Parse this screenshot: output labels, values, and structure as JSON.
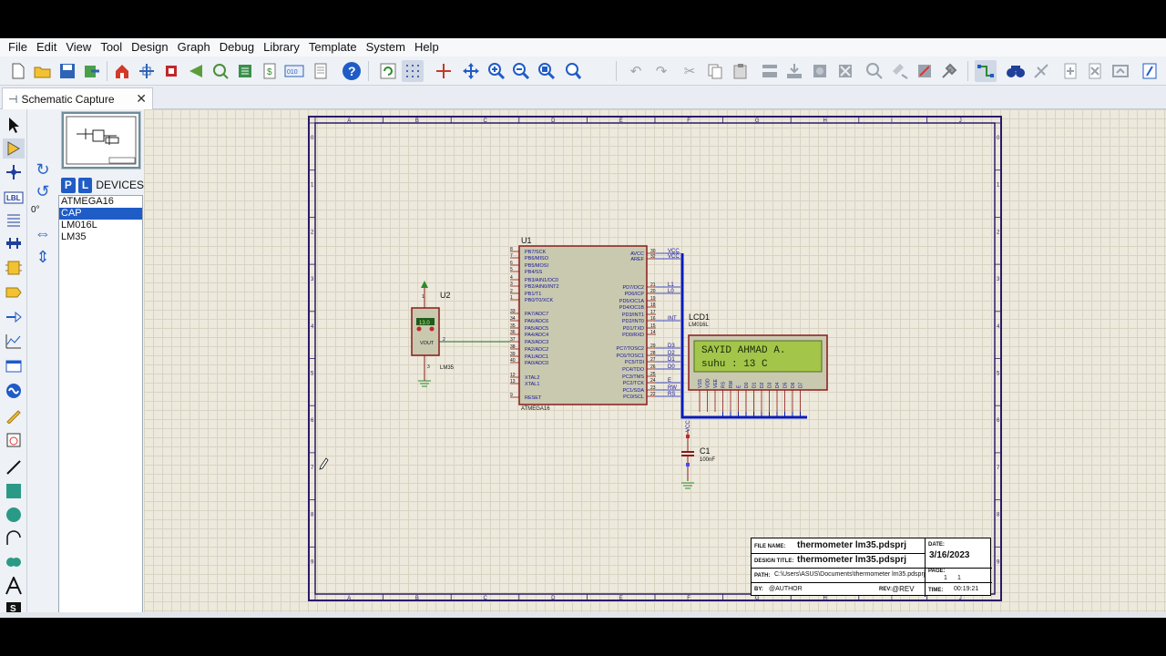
{
  "menu": [
    "File",
    "Edit",
    "View",
    "Tool",
    "Design",
    "Graph",
    "Debug",
    "Library",
    "Template",
    "System",
    "Help"
  ],
  "tab": {
    "label": "Schematic Capture"
  },
  "rotation": {
    "angle": "0°"
  },
  "devices": {
    "pick_button": "P",
    "library_button": "L",
    "title": "DEVICES",
    "items": [
      "ATMEGA16",
      "CAP",
      "LM016L",
      "LM35"
    ],
    "selected": "CAP"
  },
  "schematic": {
    "u1": {
      "ref": "U1",
      "part": "ATMEGA16",
      "left_pins": [
        "PB7/SCK",
        "PB6/MISO",
        "PB5/MOSI",
        "PB4/SS",
        "PB3/AIN1/OC0",
        "PB2/AIN0/INT2",
        "PB1/T1",
        "PB0/T0/XCK",
        "PA7/ADC7",
        "PA6/ADC6",
        "PA5/ADC5",
        "PA4/ADC4",
        "PA3/ADC3",
        "PA2/ADC2",
        "PA1/ADC1",
        "PA0/ADC0",
        "XTAL2",
        "XTAL1",
        "RESET"
      ],
      "left_nums": [
        "8",
        "7",
        "6",
        "5",
        "4",
        "3",
        "2",
        "1",
        "33",
        "34",
        "35",
        "36",
        "37",
        "38",
        "39",
        "40",
        "12",
        "13",
        "9"
      ],
      "right_pins": [
        "AVCC",
        "AREF",
        "PD7/OC2",
        "PD6/ICP",
        "PD5/OC1A",
        "PD4/OC1B",
        "PD3/INT1",
        "PD2/INT0",
        "PD1/TXD",
        "PD0/RXD",
        "PC7/TOSC2",
        "PC6/TOSC1",
        "PC5/TDI",
        "PC4/TDO",
        "PC3/TMS",
        "PC2/TCK",
        "PC1/SDA",
        "PC0/SCL"
      ],
      "right_nums": [
        "30",
        "32",
        "21",
        "20",
        "19",
        "18",
        "17",
        "16",
        "15",
        "14",
        "29",
        "28",
        "27",
        "26",
        "25",
        "24",
        "23",
        "22"
      ],
      "net_labels": [
        "VCC",
        "VCC",
        "L1",
        "L0",
        "INT",
        "D3",
        "D2",
        "D1",
        "D0",
        "E",
        "RW",
        "RS"
      ]
    },
    "u2": {
      "ref": "U2",
      "part": "LM35",
      "reading": "13.0",
      "vout": "VOUT"
    },
    "lcd": {
      "ref": "LCD1",
      "part": "LM016L",
      "line1": "SAYID AHMAD A.",
      "line2": "suhu : 13 C",
      "pins": [
        "VSS",
        "VDD",
        "VEE",
        "RS",
        "RW",
        "E",
        "D0",
        "D1",
        "D2",
        "D3",
        "D4",
        "D5",
        "D6",
        "D7"
      ]
    },
    "c1": {
      "ref": "C1",
      "value": "100nF",
      "net": "VCC"
    },
    "grid_cols": [
      "A",
      "B",
      "C",
      "D",
      "E",
      "F",
      "G",
      "H",
      "I",
      "J"
    ],
    "grid_rows": [
      "0",
      "1",
      "2",
      "3",
      "4",
      "5",
      "6",
      "7",
      "8",
      "9"
    ]
  },
  "title_block": {
    "file_name_label": "FILE NAME:",
    "file_name": "thermometer lm35.pdsprj",
    "design_title_label": "DESIGN TITLE:",
    "design_title": "thermometer lm35.pdsprj",
    "path_label": "PATH:",
    "path": "C:\\Users\\ASUS\\Documents\\thermometer lm35.pdsprj",
    "by_label": "BY:",
    "author": "@AUTHOR",
    "rev_label": "REV:",
    "rev": "@REV",
    "date_label": "DATE:",
    "date": "3/16/2023",
    "page_label": "PAGE:",
    "page": "1",
    "page_of": "1",
    "time_label": "TIME:",
    "time": "00:19:21"
  },
  "colors": {
    "wire_bus": "#0a1ab8",
    "component_body": "#c9c9b0",
    "outline": "#8b1a1a",
    "pin_text": "#16149a",
    "lcd_screen": "#a3c64a",
    "accent": "#1f5cc6"
  }
}
